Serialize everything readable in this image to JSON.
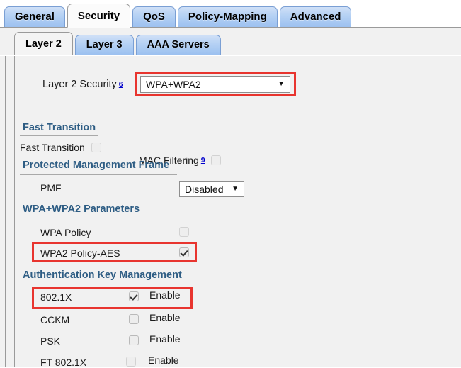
{
  "main_tabs": [
    {
      "label": "General",
      "active": false
    },
    {
      "label": "Security",
      "active": true
    },
    {
      "label": "QoS",
      "active": false
    },
    {
      "label": "Policy-Mapping",
      "active": false
    },
    {
      "label": "Advanced",
      "active": false
    }
  ],
  "sub_tabs": [
    {
      "label": "Layer 2",
      "active": true
    },
    {
      "label": "Layer 3",
      "active": false
    },
    {
      "label": "AAA Servers",
      "active": false
    }
  ],
  "layer2": {
    "security_label": "Layer 2 Security",
    "security_footnote": "6",
    "security_value": "WPA+WPA2",
    "mac_filtering_label": "MAC Filtering",
    "mac_filtering_footnote": "9",
    "mac_filtering_checked": false
  },
  "fast_transition": {
    "header": "Fast Transition",
    "row_label": "Fast Transition",
    "checked": false
  },
  "pmf": {
    "header": "Protected Management Frame",
    "row_label": "PMF",
    "value": "Disabled"
  },
  "wpa_params": {
    "header": "WPA+WPA2 Parameters",
    "rows": [
      {
        "label": "WPA Policy",
        "checked": false
      },
      {
        "label": "WPA2 Policy-AES",
        "checked": true
      }
    ]
  },
  "akm": {
    "header": "Authentication Key Management",
    "enable_label": "Enable",
    "rows": [
      {
        "label": "802.1X",
        "checked": true
      },
      {
        "label": "CCKM",
        "checked": false
      },
      {
        "label": "PSK",
        "checked": false
      },
      {
        "label": "FT 802.1X",
        "checked": false
      }
    ]
  },
  "icons": {
    "dropdown_caret": "▼"
  },
  "colors": {
    "highlight": "#e8352f",
    "section_header": "#2e5d84",
    "tab_blue": "#9cc1f0",
    "footnote_link": "#0000cc"
  }
}
